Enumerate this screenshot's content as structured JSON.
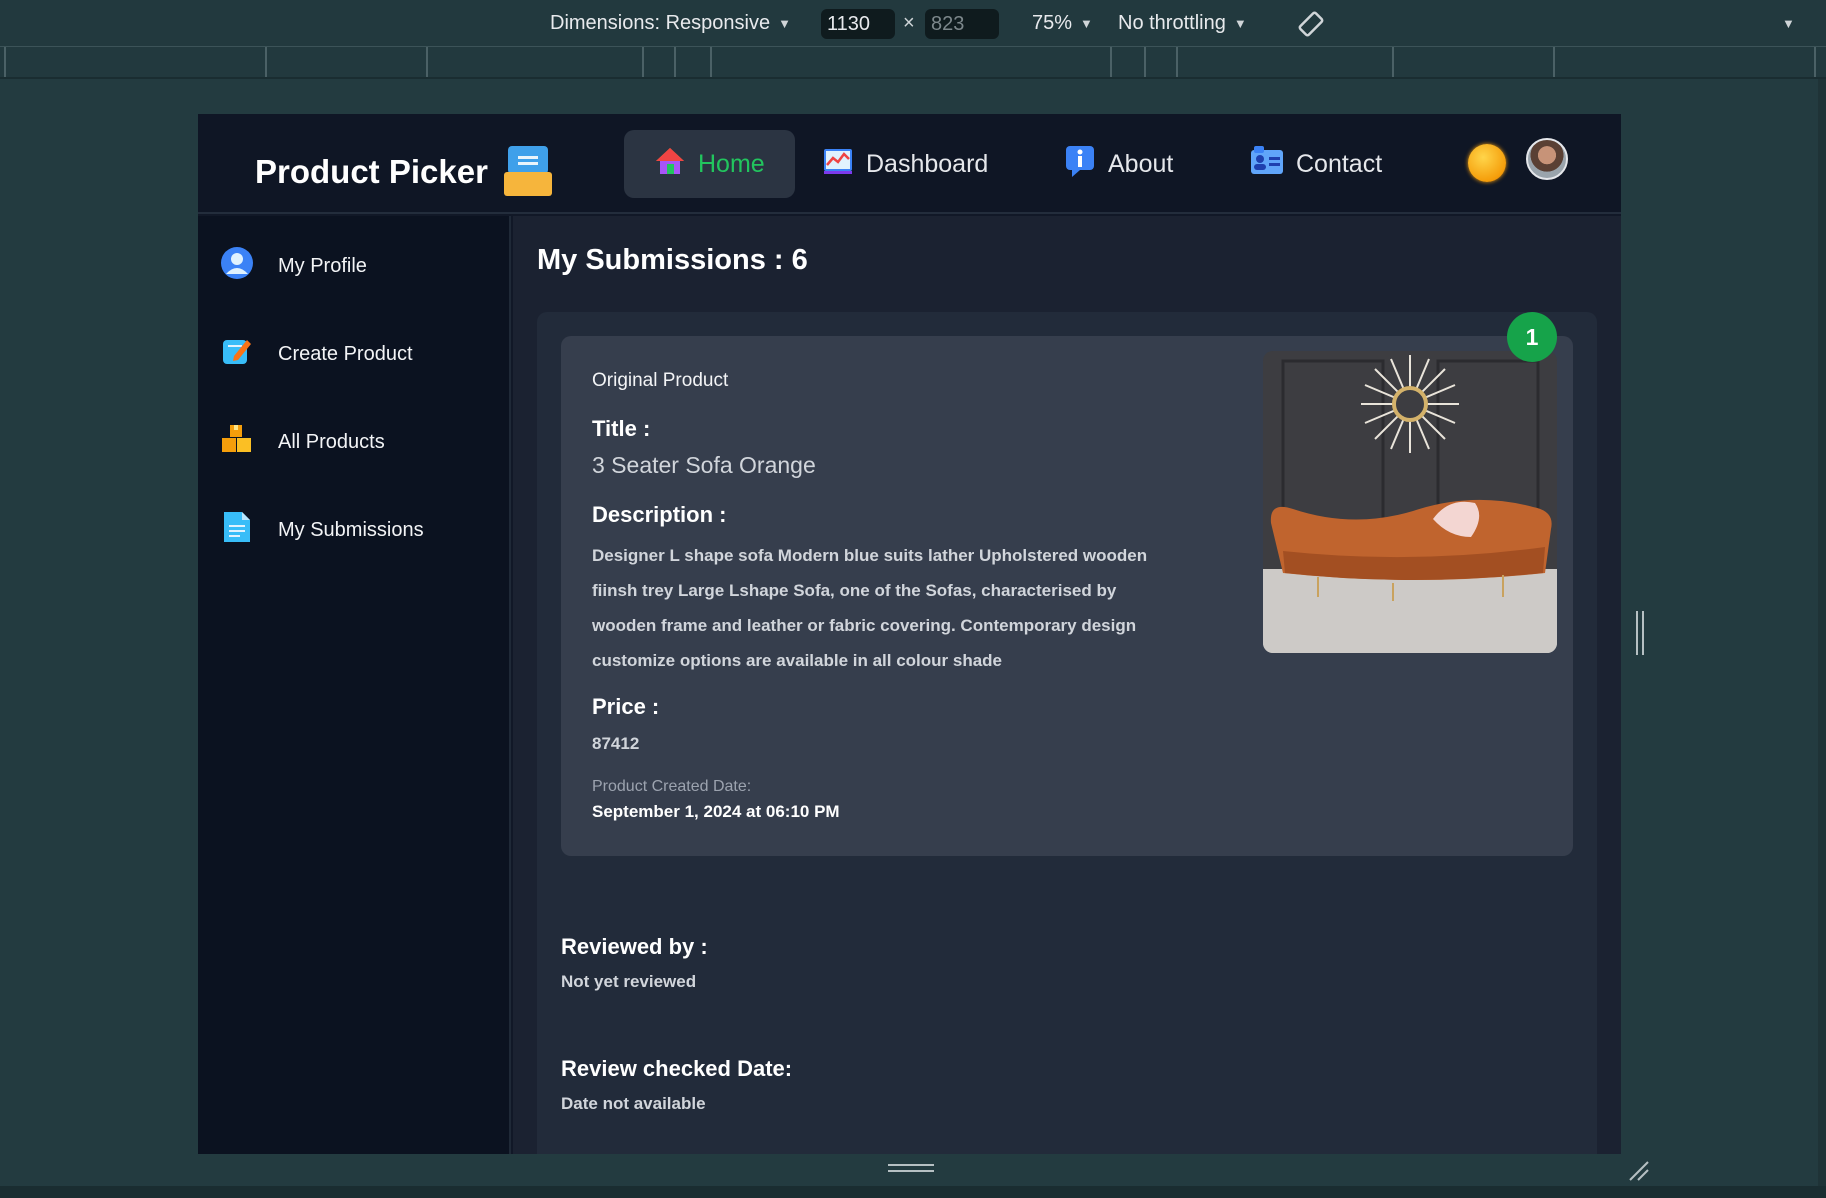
{
  "devtools": {
    "dimensions_label": "Dimensions: Responsive",
    "width_value": "1130",
    "times": "×",
    "height_value": "823",
    "zoom": "75%",
    "throttling": "No throttling"
  },
  "navbar": {
    "brand": "Product Picker",
    "links": [
      {
        "label": "Home",
        "active": true
      },
      {
        "label": "Dashboard",
        "active": false
      },
      {
        "label": "About",
        "active": false
      },
      {
        "label": "Contact",
        "active": false
      }
    ]
  },
  "sidebar": {
    "items": [
      {
        "label": "My Profile",
        "icon": "user-icon"
      },
      {
        "label": "Create Product",
        "icon": "edit-icon"
      },
      {
        "label": "All Products",
        "icon": "boxes-icon"
      },
      {
        "label": "My Submissions",
        "icon": "document-icon"
      }
    ]
  },
  "main": {
    "title": "My Submissions : 6",
    "submission": {
      "index": "1",
      "original_label": "Original Product",
      "title_label": "Title :",
      "title": "3 Seater Sofa Orange",
      "description_label": "Description :",
      "description": "Designer L shape sofa Modern blue suits lather Upholstered wooden fiinsh trey Large Lshape Sofa, one of the Sofas, characterised by wooden frame and leather or fabric covering. Contemporary design customize options are available in all colour shade",
      "price_label": "Price :",
      "price": "87412",
      "created_label": "Product Created Date:",
      "created_date": "September 1, 2024 at 06:10 PM",
      "reviewed_by_label": "Reviewed by :",
      "reviewed_by": "Not yet reviewed",
      "review_date_label": "Review checked Date:",
      "review_date": "Date not available"
    }
  },
  "colors": {
    "accent_green": "#22c55e",
    "badge_green": "#16a34a",
    "sidebar_bg": "#0b1220",
    "main_bg": "#1b2231"
  }
}
